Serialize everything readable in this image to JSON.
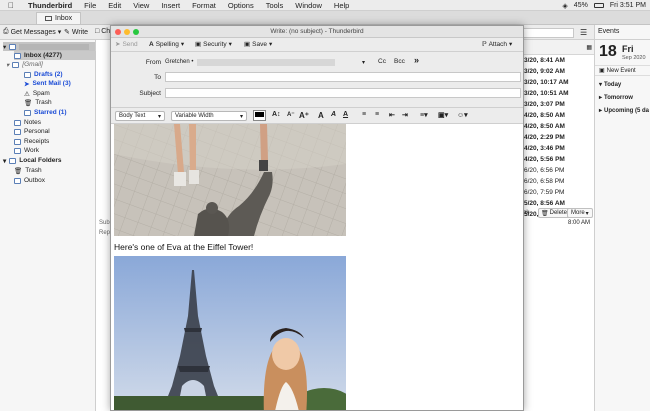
{
  "menubar": {
    "app": "Thunderbird",
    "items": [
      "File",
      "Edit",
      "View",
      "Insert",
      "Format",
      "Options",
      "Tools",
      "Window",
      "Help"
    ],
    "battery": "45%",
    "clock": "Fri 3:51 PM"
  },
  "tab": {
    "label": "Inbox"
  },
  "main_toolbar": {
    "get_messages": "Get Messages",
    "write": "Write",
    "chat": "Ch"
  },
  "folders": {
    "account": "",
    "inbox": "Inbox (4277)",
    "gmail": "[Gmail]",
    "drafts": "Drafts (2)",
    "sent": "Sent Mail (3)",
    "spam": "Spam",
    "trash": "Trash",
    "starred": "Starred (1)",
    "notes": "Notes",
    "personal": "Personal",
    "receipts": "Receipts",
    "work": "Work",
    "local": "Local Folders",
    "local_trash": "Trash",
    "outbox": "Outbox"
  },
  "message_dates": [
    "3/20, 8:41 AM",
    "3/20, 9:02 AM",
    "3/20, 10:17 AM",
    "3/20, 10:51 AM",
    "3/20, 3:07 PM",
    "4/20, 8:50 AM",
    "4/20, 8:50 AM",
    "4/20, 2:29 PM",
    "4/20, 3:46 PM",
    "4/20, 5:56 PM",
    "6/20, 6:56 PM",
    "6/20, 6:58 PM",
    "6/20, 7:59 PM",
    "5/20, 8:56 AM",
    "5/20, 11:06 AM"
  ],
  "preview": {
    "delete": "Delete",
    "more": "More",
    "time": "8:00 AM",
    "sub": "Sub",
    "rep": "Rep",
    "nk": "nk"
  },
  "events": {
    "header": "Events",
    "day": "18",
    "dayname": "Fri",
    "monyr": "Sep 2020",
    "new_event": "New Event",
    "today": "Today",
    "tomorrow": "Tomorrow",
    "upcoming": "Upcoming (5 da"
  },
  "compose": {
    "title": "Write: (no subject) - Thunderbird",
    "send": "Send",
    "spelling": "Spelling",
    "security": "Security",
    "save": "Save",
    "attach": "Attach",
    "from_label": "From",
    "from_value": "Gretchen •",
    "cc": "Cc",
    "bcc": "Bcc",
    "to_label": "To",
    "subject_label": "Subject",
    "para_style": "Body Text",
    "font": "Variable Width",
    "body_text": "Here's one of Eva at the Eiffel Tower!"
  }
}
